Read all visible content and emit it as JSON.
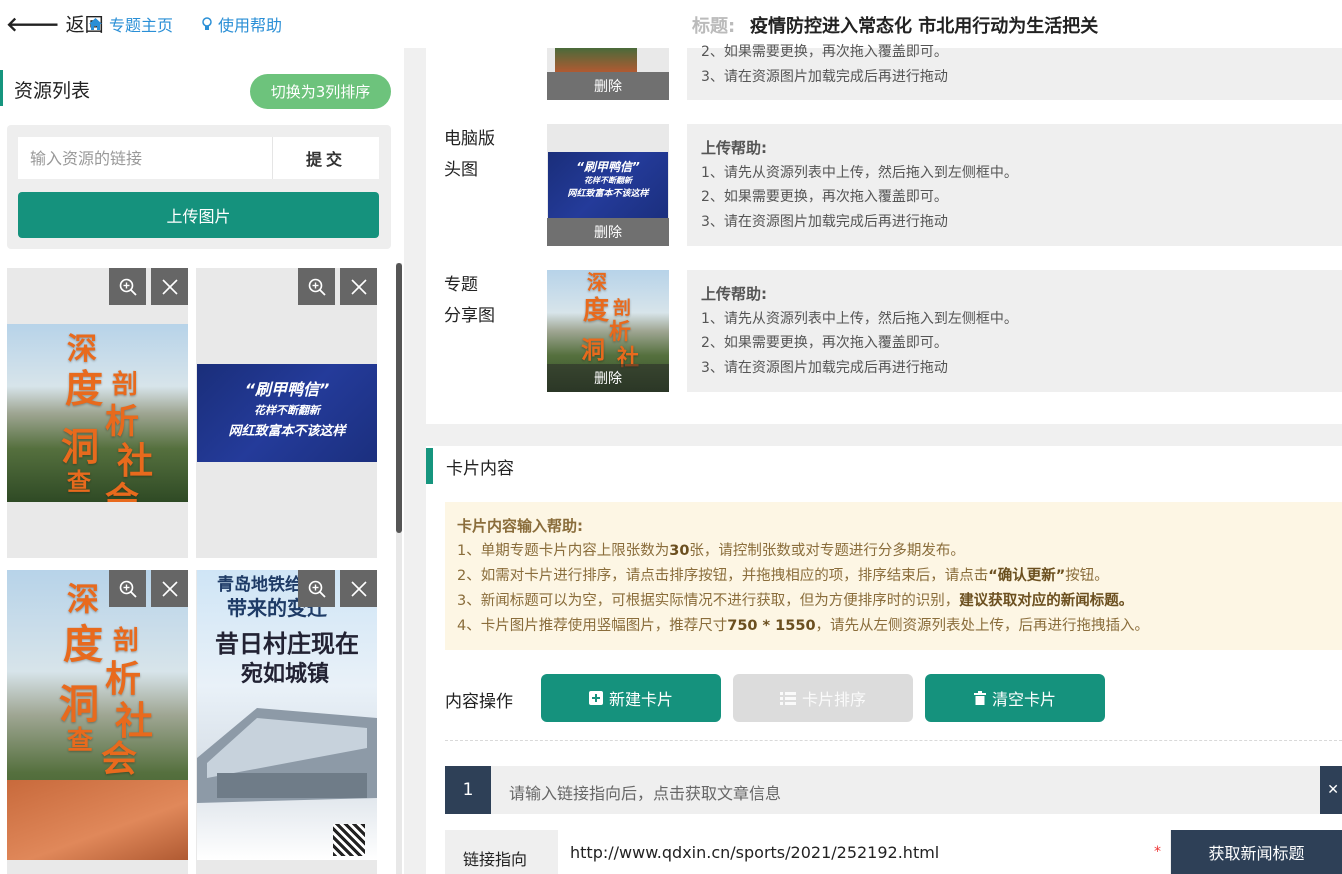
{
  "topbar": {
    "back_label": "返回",
    "home_label": "专题主页",
    "help_label": "使用帮助",
    "title_label": "标题:",
    "title_text": "疫情防控进入常态化 市北用行动为生活把关"
  },
  "resources": {
    "title": "资源列表",
    "switch_label": "切换为3列排序",
    "url_placeholder": "输入资源的链接",
    "submit_label": "提交",
    "upload_label": "上传图片"
  },
  "thumbs": {
    "forest_chars": [
      "深",
      "度",
      "剖",
      "析",
      "洞",
      "社",
      "查",
      "会"
    ],
    "blue_line1": "“刷甲鸭信”",
    "blue_line2": "花样不断翻新",
    "blue_line3": "网红致富本不该这样",
    "city_line1": "青岛地铁给我们",
    "city_line2": "带来的变迁",
    "city_line3": "昔日村庄现在",
    "city_line4": "宛如城镇"
  },
  "image_slots": {
    "delete_label": "删除",
    "pc_label_1": "电脑版",
    "pc_label_2": "头图",
    "share_label_1": "专题",
    "share_label_2": "分享图",
    "help_title": "上传帮助:",
    "help_1": "1、请先从资源列表中上传，然后拖入到左侧框中。",
    "help_2": "2、如果需要更换，再次拖入覆盖即可。",
    "help_3": "3、请在资源图片加载完成后再进行拖动"
  },
  "cards": {
    "title": "卡片内容",
    "help_title": "卡片内容输入帮助:",
    "help_1_a": "1、单期专题卡片内容上限张数为",
    "help_1_b": "30",
    "help_1_c": "张，请控制张数或对专题进行分多期发布。",
    "help_2_a": "2、如需对卡片进行排序，请点击排序按钮，并拖拽相应的项，排序结束后，请点击",
    "help_2_b": "“确认更新”",
    "help_2_c": "按钮。",
    "help_3_a": "3、新闻标题可以为空，可根据实际情况不进行获取，但为方便排序时的识别，",
    "help_3_b": "建议获取对应的新闻标题。",
    "help_4_a": "4、卡片图片推荐使用竖幅图片，推荐尺寸",
    "help_4_b": "750 * 1550",
    "help_4_c": "，请先从左侧资源列表处上传，后再进行拖拽插入。",
    "ops_label": "内容操作",
    "new_label": "新建卡片",
    "sort_label": "卡片排序",
    "clear_label": "清空卡片",
    "card_number": "1",
    "card_hint": "请输入链接指向后，点击获取文章信息",
    "link_label": "链接指向",
    "link_value": "http://www.qdxin.cn/sports/2021/252192.html",
    "required_mark": "*",
    "fetch_label": "获取新闻标题"
  }
}
